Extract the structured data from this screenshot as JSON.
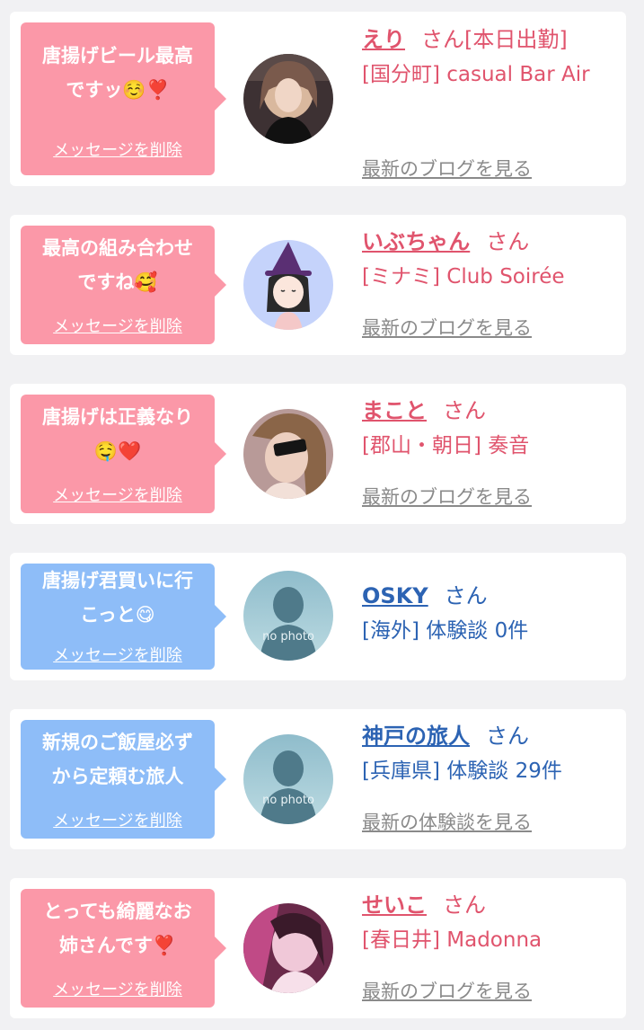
{
  "delete_label": "メッセージを削除",
  "san": "さん",
  "colors": {
    "pink_bubble": "#fb98a8",
    "blue_bubble": "#8ebdf8",
    "pink_text": "#e0546d",
    "blue_text": "#2c63b3"
  },
  "items": [
    {
      "message_l1": "唐揚げビール最高",
      "message_l2": "ですッ☺️❣️",
      "name": "えり",
      "name_suffix": "[本日出勤]",
      "shop": "[国分町] casual Bar Air",
      "link": "最新のブログを見る",
      "avatar": "girl-photo-avatar"
    },
    {
      "message_l1": "最高の組み合わせ",
      "message_l2": "ですね🥰",
      "name": "いぶちゃん",
      "name_suffix": "",
      "shop": "[ミナミ] Club Soirée",
      "link": "最新のブログを見る",
      "avatar": "witch-illustration-avatar"
    },
    {
      "message_l1": "唐揚げは正義なり",
      "message_l2": "🤤❤️",
      "name": "まこと",
      "name_suffix": "",
      "shop": "[郡山・朝日] 奏音",
      "link": "最新のブログを見る",
      "avatar": "girl-photo-avatar"
    },
    {
      "message_l1": "唐揚げ君買いに行",
      "message_l2": "こっと😋",
      "name": "OSKY",
      "name_suffix": "",
      "shop": "[海外] 体験談 0件",
      "link": "",
      "avatar": "no-photo-avatar",
      "no_photo": "no photo"
    },
    {
      "message_l1": "新規のご飯屋必ず",
      "message_l2": "から定頼む旅人",
      "name": "神戸の旅人",
      "name_suffix": "",
      "shop": "[兵庫県] 体験談 29件",
      "link": "最新の体験談を見る",
      "avatar": "no-photo-avatar",
      "no_photo": "no photo"
    },
    {
      "message_l1": "とっても綺麗なお",
      "message_l2": "姉さんです❣️",
      "name": "せいこ",
      "name_suffix": "",
      "shop": "[春日井] Madonna",
      "link": "最新のブログを見る",
      "avatar": "girl-photo-avatar"
    }
  ]
}
